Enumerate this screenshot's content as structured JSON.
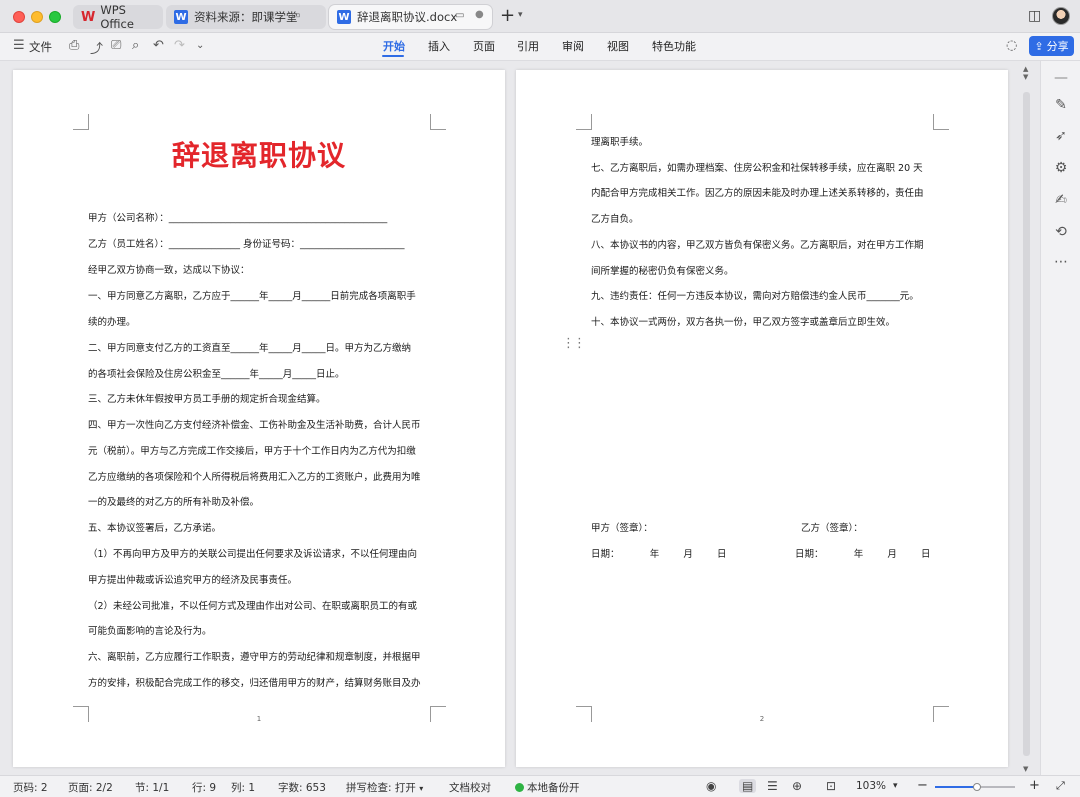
{
  "titlebar": {
    "tabs": [
      {
        "label": "WPS Office",
        "icon": "wps-logo"
      },
      {
        "label": "资料来源：即课学堂",
        "icon": "word-doc-icon"
      },
      {
        "label": "辞退离职协议.docx",
        "icon": "word-doc-icon"
      }
    ],
    "wps_logo_text": "W",
    "doc_logo_text": "W"
  },
  "toolbar": {
    "file_label": "文件",
    "menu_tabs": [
      "开始",
      "插入",
      "页面",
      "引用",
      "审阅",
      "视图",
      "特色功能"
    ],
    "active_tab": "开始",
    "share_label": "分享"
  },
  "document": {
    "title": "辞退离职协议",
    "page1_lines": [
      "甲方（公司名称）：______________________________________________",
      "乙方（员工姓名）：_______________      身份证号码：______________________",
      "经甲乙双方协商一致，达成以下协议：",
      "一、甲方同意乙方离职，乙方应于______年_____月______日前完成各项离职手",
      "续的办理。",
      "二、甲方同意支付乙方的工资直至______年_____月_____日。甲方为乙方缴纳",
      "的各项社会保险及住房公积金至______年_____月_____日止。",
      "三、乙方未休年假按甲方员工手册的规定折合现金结算。",
      "四、甲方一次性向乙方支付经济补偿金、工伤补助金及生活补助费，合计人民币",
      "元（税前）。甲方与乙方完成工作交接后，甲方于十个工作日内为乙方代为扣缴",
      "乙方应缴纳的各项保险和个人所得税后将费用汇入乙方的工资账户，此费用为唯",
      "一的及最终的对乙方的所有补助及补偿。",
      "五、本协议签署后，乙方承诺。",
      "（1）不再向甲方及甲方的关联公司提出任何要求及诉讼请求，不以任何理由向",
      "甲方提出仲裁或诉讼追究甲方的经济及民事责任。",
      "（2）未经公司批准，不以任何方式及理由作出对公司、在职或离职员工的有或",
      "可能负面影响的言论及行为。",
      "六、离职前，乙方应履行工作职责，遵守甲方的劳动纪律和规章制度，并根据甲",
      "方的安排，积极配合完成工作的移交，归还借用甲方的财产，结算财务账目及办"
    ],
    "page2_lines": [
      "理离职手续。",
      "七、乙方离职后，如需办理档案、住房公积金和社保转移手续，应在离职 20 天",
      "内配合甲方完成相关工作。因乙方的原因未能及时办理上述关系转移的，责任由",
      "乙方自负。",
      "八、本协议书的内容，甲乙双方皆负有保密义务。乙方离职后，对在甲方工作期",
      "间所掌握的秘密仍负有保密义务。",
      "九、违约责任：任何一方违反本协议，需向对方赔偿违约金人民币_______元。",
      "十、本协议一式两份，双方各执一份，甲乙双方签字或盖章后立即生效。"
    ],
    "sign_a": "甲方（签章）：",
    "sign_b": "乙方（签章）：",
    "date_a": "日期：          年        月        日",
    "date_b": "日期：          年        月        日",
    "page1_number": "1",
    "page2_number": "2"
  },
  "statusbar": {
    "page_code": "页码: 2",
    "pages": "页面: 2/2",
    "section": "节: 1/1",
    "row": "行: 9",
    "col": "列: 1",
    "word_count": "字数: 653",
    "spellcheck": "拼写检查: 打开",
    "proofread": "文档校对",
    "backup": "本地备份开",
    "zoom": "103%",
    "zoom_level": 0.52
  },
  "colors": {
    "accent": "#2f6ce5",
    "title_red": "#e3262b",
    "backup_green": "#2fb344"
  }
}
